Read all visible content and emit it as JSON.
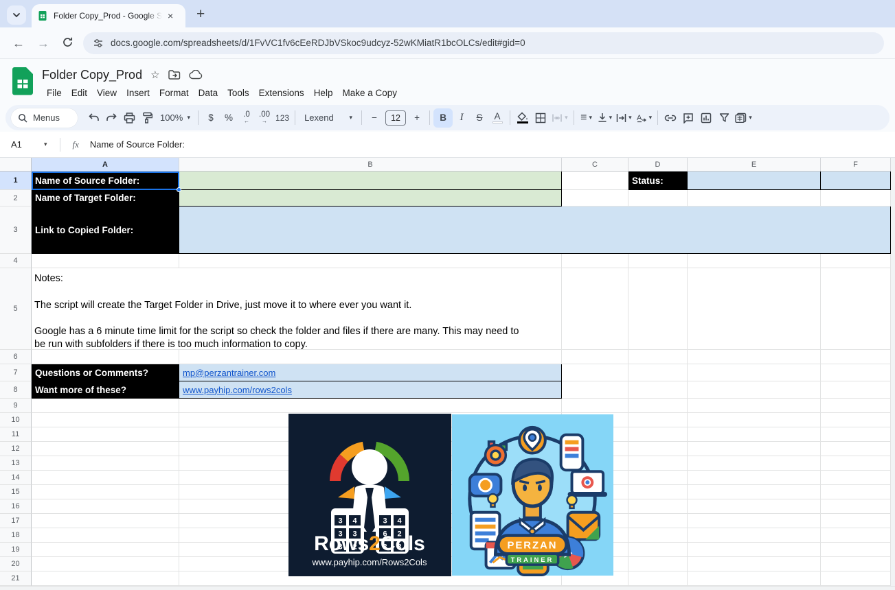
{
  "browser": {
    "tab_title": "Folder Copy_Prod - Google She",
    "url": "docs.google.com/spreadsheets/d/1FvVC1fv6cEeRDJbVSkoc9udcyz-52wKMiatR1bcOLCs/edit#gid=0"
  },
  "icons": {
    "close": "×",
    "new_tab": "+",
    "back": "←",
    "forward": "→",
    "star": "☆",
    "caret_down": "▾",
    "minus": "−",
    "plus": "+",
    "dollar": "$",
    "percent": "%",
    "bold": "B",
    "italic": "I",
    "strikethrough": "S",
    "text_color": "A",
    "align_left": "≡",
    "decrease_decimal_arrow": "←",
    "increase_decimal_arrow": "→"
  },
  "app": {
    "title": "Folder Copy_Prod",
    "menus": [
      "File",
      "Edit",
      "View",
      "Insert",
      "Format",
      "Data",
      "Tools",
      "Extensions",
      "Help",
      "Make a Copy"
    ]
  },
  "toolbar": {
    "search_label": "Menus",
    "zoom": "100%",
    "dec_dec": ".0",
    "dec_inc": ".00",
    "num_format": "123",
    "font": "Lexend",
    "font_size": "12"
  },
  "formula_bar": {
    "cell_ref": "A1",
    "fx": "fx",
    "value": "Name of Source Folder:"
  },
  "grid": {
    "columns": [
      "A",
      "B",
      "C",
      "D",
      "E",
      "F"
    ],
    "rows": [
      "1",
      "2",
      "3",
      "4",
      "5",
      "6",
      "7",
      "8",
      "9",
      "10",
      "11",
      "12",
      "13",
      "14",
      "15",
      "16",
      "17",
      "18",
      "19",
      "20",
      "21"
    ],
    "cells": {
      "a1": "Name of Source Folder:",
      "a2": "Name of Target Folder:",
      "a3": "Link to Copied Folder:",
      "d1": "Status:",
      "notes": "Notes:\n\nThe script will create the Target Folder in Drive, just move it to where ever you want it.\n\nGoogle has a 6 minute time limit for the script so check the folder and files if there are many. This may need to be run with subfolders if there is too much information to copy.",
      "a7": "Questions or Comments?",
      "b7": "mp@perzantrainer.com",
      "a8": "Want more of these?",
      "b8": "www.payhip.com/rows2cols"
    }
  },
  "images": {
    "rows2cols": {
      "brand_parts": [
        "Rows",
        "2",
        "Cols"
      ],
      "site": "www.payhip.com/Rows2Cols",
      "calc_left": [
        "3",
        "4",
        "3",
        "3",
        "3",
        "2"
      ],
      "calc_right": [
        "3",
        "4",
        "6",
        "2",
        "3",
        "3"
      ]
    },
    "perzan": {
      "badge_top": "PERZAN",
      "badge_bottom": "TRAINER"
    }
  },
  "colors": {
    "accent_blue": "#1a73e8",
    "selected_header": "#d3e3fd",
    "cell_black": "#000000",
    "cell_green": "#d9ead3",
    "cell_blue": "#cfe2f3",
    "link": "#1155cc",
    "sheets_green": "#12a15a",
    "logo_navy": "#0e1c30",
    "perzan_sky": "#85d6f7"
  }
}
